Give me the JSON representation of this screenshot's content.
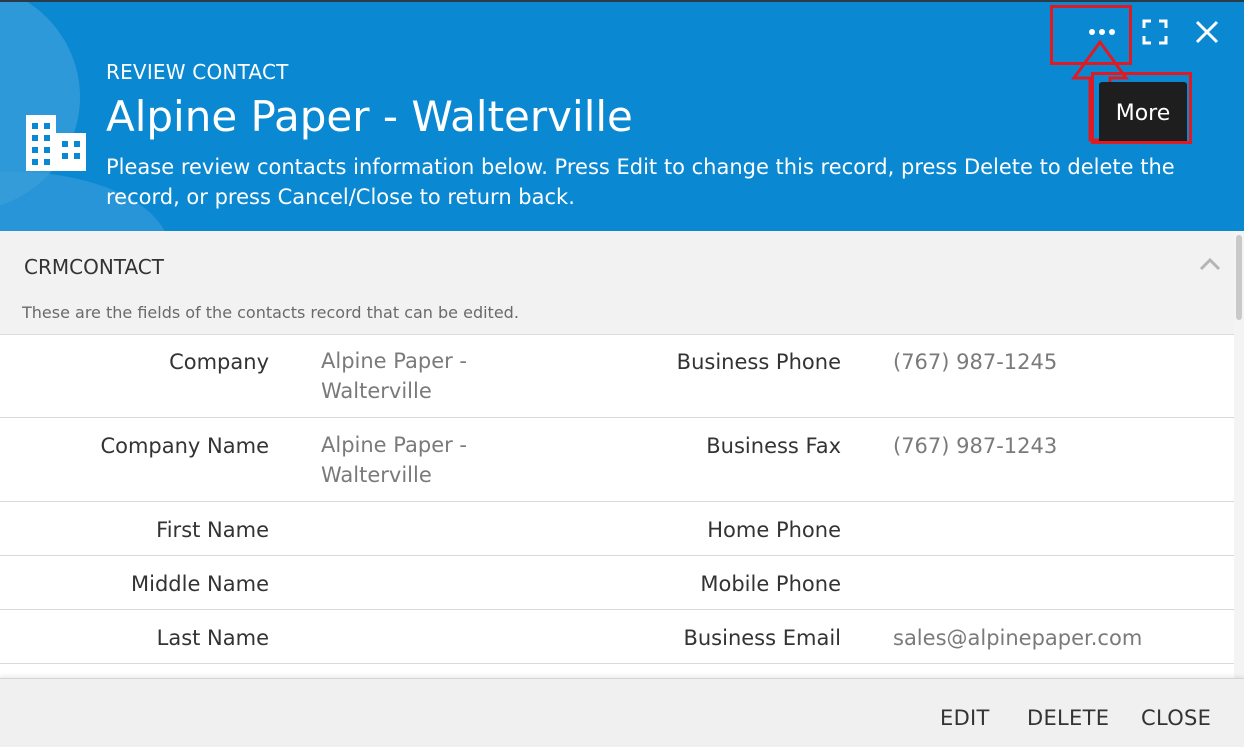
{
  "header": {
    "eyebrow": "REVIEW CONTACT",
    "title": "Alpine Paper - Walterville",
    "description": "Please review contacts information below. Press Edit to change this record, press Delete to delete the record, or press Cancel/Close to return back.",
    "icon": "building-icon",
    "more_icon": "more-dots-icon",
    "expand_icon": "expand-icon",
    "close_icon": "close-icon",
    "tooltip": "More",
    "accent_color": "#0b88d2",
    "highlight_color": "#e01a22"
  },
  "section": {
    "title": "CRMCONTACT",
    "subtitle": "These are the fields of the contacts record that can be edited.",
    "chevron_icon": "chevron-up-icon"
  },
  "fields": [
    {
      "left_label": "Company",
      "left_value": "Alpine Paper - Walterville",
      "right_label": "Business Phone",
      "right_value": "(767) 987-1245"
    },
    {
      "left_label": "Company Name",
      "left_value": "Alpine Paper - Walterville",
      "right_label": "Business Fax",
      "right_value": "(767) 987-1243"
    },
    {
      "left_label": "First Name",
      "left_value": "",
      "right_label": "Home Phone",
      "right_value": ""
    },
    {
      "left_label": "Middle Name",
      "left_value": "",
      "right_label": "Mobile Phone",
      "right_value": ""
    },
    {
      "left_label": "Last Name",
      "left_value": "",
      "right_label": "Business Email",
      "right_value": "sales@alpinepaper.com"
    }
  ],
  "footer": {
    "edit_label": "EDIT",
    "delete_label": "DELETE",
    "close_label": "CLOSE"
  }
}
